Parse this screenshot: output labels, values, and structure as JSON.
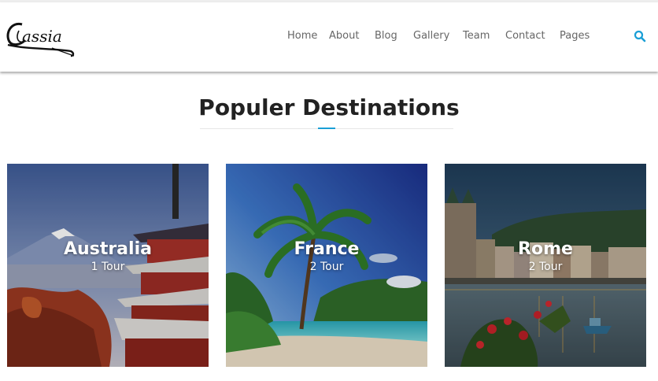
{
  "brand": {
    "logo_text": "Cassia"
  },
  "nav": {
    "items": [
      {
        "label": "Home"
      },
      {
        "label": "About"
      },
      {
        "label": "Blog"
      },
      {
        "label": "Gallery"
      },
      {
        "label": "Team"
      },
      {
        "label": "Contact"
      },
      {
        "label": "Pages"
      }
    ],
    "search_icon": "search-icon",
    "accent_color": "#1a9fd6"
  },
  "section": {
    "title": "Populer Destinations"
  },
  "destinations": [
    {
      "name": "Australia",
      "tours": "1 Tour"
    },
    {
      "name": "France",
      "tours": "2 Tour"
    },
    {
      "name": "Rome",
      "tours": "2 Tour"
    }
  ]
}
